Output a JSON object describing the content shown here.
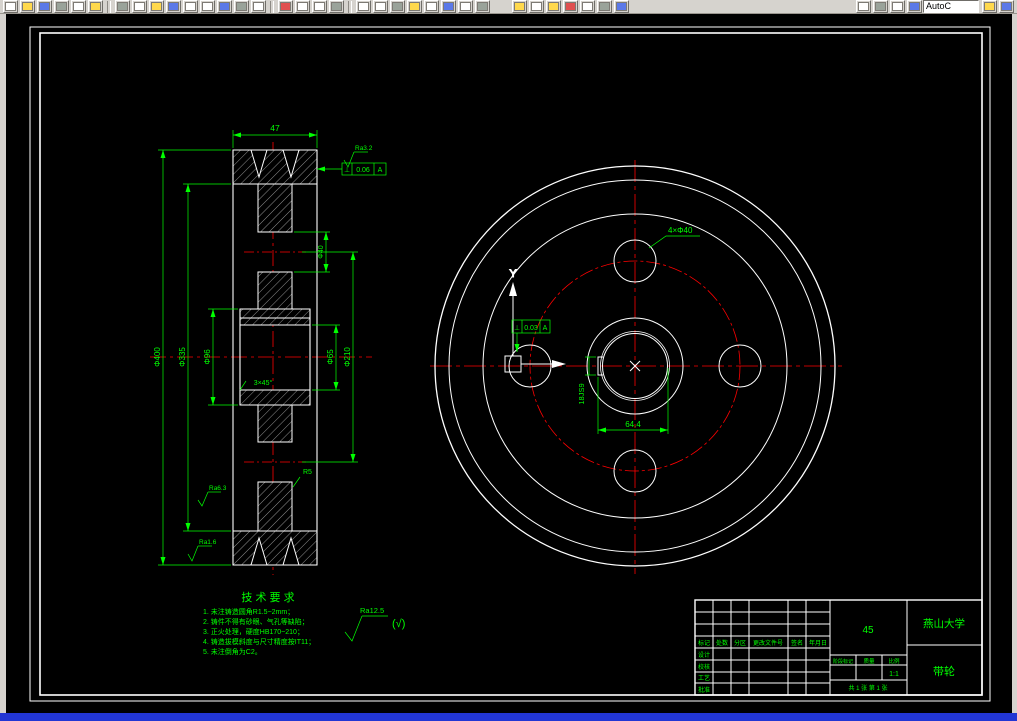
{
  "colors": {
    "canvas": "#000000",
    "lines": "#ffffff",
    "dimensions": "#00ff00",
    "centerlines": "#ff0000",
    "chrome": "#d6d3ce",
    "bottom_bar": "#2236d4"
  },
  "toolbar": {
    "title_fragment": "AutoC",
    "icon_names": [
      "new",
      "open",
      "save",
      "print",
      "print-preview",
      "spell",
      "cut",
      "copy",
      "paste",
      "match-properties",
      "undo",
      "redo",
      "hyperlink",
      "find",
      "calculator",
      "redraw",
      "regen",
      "zoom-window",
      "pan",
      "snap",
      "grid",
      "ortho",
      "osnap",
      "polar",
      "object-track",
      "lineweight",
      "model",
      "layers",
      "layer-control",
      "make-object-layer",
      "color-control",
      "linetype-control",
      "lineweight-control",
      "plot-style",
      "distance",
      "area",
      "list",
      "locate-point",
      "help",
      "about"
    ]
  },
  "left_view": {
    "dim_width": "47",
    "dia_outer": "Φ400",
    "dia_rim_inner": "Φ335",
    "dia_hub": "Φ96",
    "dia_bore": "Φ65",
    "dia_bolt_circle": "Φ210",
    "dia_hole": "Φ40",
    "chamfer_note": "3×45°",
    "fillet_note": "R5",
    "roughness_top": "Ra3.2",
    "roughness_mid": "Ra6.3",
    "roughness_bottom": "Ra1.6",
    "gdt": {
      "symbol": "⊥",
      "value": "0.06",
      "datum": "A"
    }
  },
  "right_view": {
    "holes_note": "4×Φ40",
    "keyway_width": "18JS9",
    "keyway_depth": "64.4",
    "ucs_y_label": "Y",
    "gdt": {
      "symbol": "⊥",
      "value": "0.03",
      "datum": "A"
    }
  },
  "tech_req": {
    "title": "技 术 要 求",
    "lines": [
      "1. 未注铸造圆角R1.5~2mm；",
      "2. 铸件不得有砂眼、气孔等缺陷；",
      "3. 正火处理，硬度HB170~210；",
      "4. 铸造拔模斜度与尺寸精度按IT11；",
      "5. 未注倒角为C2。"
    ],
    "other_roughness": "Ra12.5",
    "other_roughness_suffix": "(√)"
  },
  "title_block": {
    "school": "燕山大学",
    "part_name": "带轮",
    "material": "45",
    "stage_label": "阶段标记",
    "mass_label": "质量",
    "scale_label": "比例",
    "scale": "1:1",
    "sheets": "共 1 张 第 1 张",
    "header": [
      "标记",
      "处数",
      "分区",
      "更改文件号",
      "签名",
      "年月日"
    ],
    "rows": [
      "设计",
      "校核",
      "工艺",
      "批准"
    ]
  }
}
